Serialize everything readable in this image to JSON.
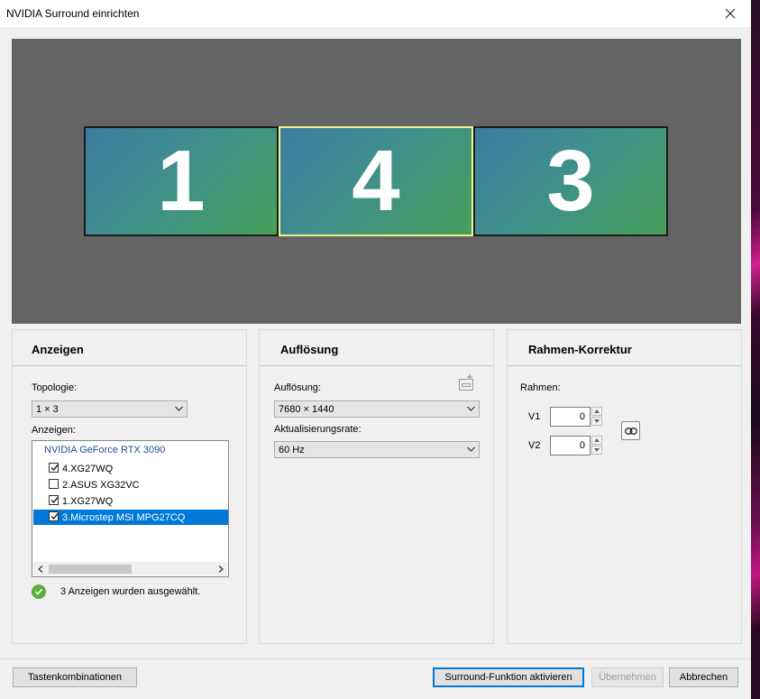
{
  "window": {
    "title": "NVIDIA Surround einrichten"
  },
  "preview": {
    "monitors": [
      {
        "label": "1",
        "selected": false
      },
      {
        "label": "4",
        "selected": true
      },
      {
        "label": "3",
        "selected": false
      }
    ]
  },
  "anzeigen_panel": {
    "title": "Anzeigen",
    "topology_label": "Topologie:",
    "topology_value": "1 × 3",
    "displays_label": "Anzeigen:",
    "gpu_name": "NVIDIA GeForce RTX 3090",
    "displays": [
      {
        "label": "4.XG27WQ",
        "checked": true,
        "selected": false
      },
      {
        "label": "2.ASUS XG32VC",
        "checked": false,
        "selected": false
      },
      {
        "label": "1.XG27WQ",
        "checked": true,
        "selected": false
      },
      {
        "label": "3.Microstep MSI MPG27CQ",
        "checked": true,
        "selected": true
      }
    ],
    "status_text": "3 Anzeigen wurden ausgewählt."
  },
  "aufloesung_panel": {
    "title": "Auflösung",
    "resolution_label": "Auflösung:",
    "resolution_value": "7680 × 1440",
    "refresh_label": "Aktualisierungsrate:",
    "refresh_value": "60 Hz"
  },
  "rahmen_panel": {
    "title": "Rahmen-Korrektur",
    "rahmen_label": "Rahmen:",
    "v1_label": "V1",
    "v1_value": "0",
    "v2_label": "V2",
    "v2_value": "0"
  },
  "buttons": {
    "shortcuts": "Tastenkombinationen",
    "activate": "Surround-Funktion aktivieren",
    "apply": "Übernehmen",
    "cancel": "Abbrechen"
  },
  "colors": {
    "accent": "#0078d7",
    "preview_bg": "#646464",
    "selected_monitor_border": "#f2ee8c",
    "status_ok": "#5dad36",
    "gpu_text": "#1f4e9a"
  },
  "icons": {
    "close": "close-icon",
    "status": "checkmark-circle-icon",
    "link": "link-icon",
    "add_display": "add-display-icon"
  }
}
